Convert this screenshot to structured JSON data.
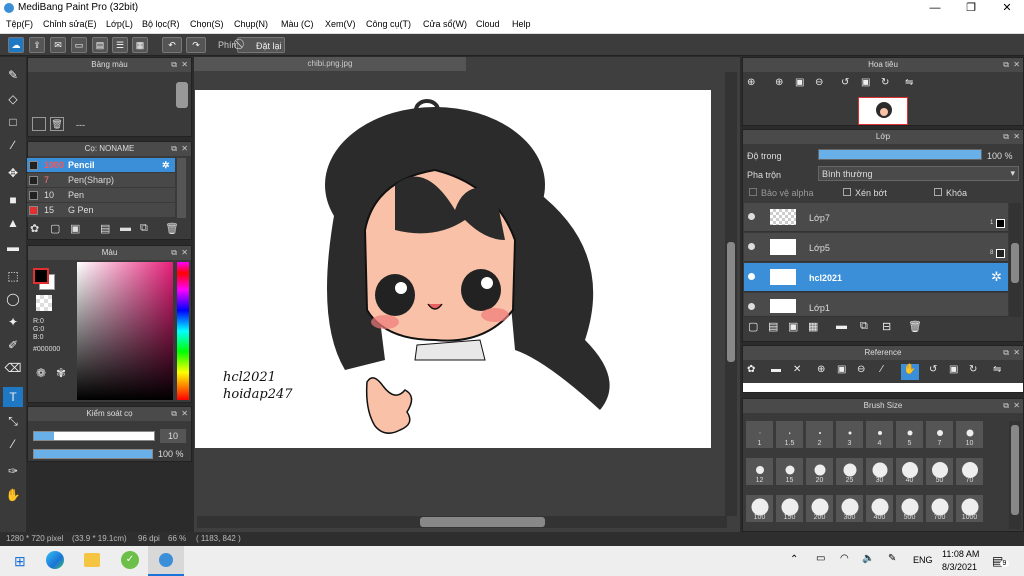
{
  "window": {
    "title": "MediBang Paint Pro (32bit)"
  },
  "menu": [
    "Tệp(F)",
    "Chỉnh sửa(E)",
    "Lớp(L)",
    "Bộ lọc(R)",
    "Chọn(S)",
    "Chụp(N)",
    "Màu (C)",
    "Xem(V)",
    "Công cụ(T)",
    "Cửa sổ(W)",
    "Cloud",
    "Help"
  ],
  "toolbar": {
    "shortcut_label": "Phím",
    "reset_label": "Đặt lại"
  },
  "panels": {
    "palette": {
      "title": "Bảng màu",
      "dash": "---"
    },
    "brush": {
      "title": "Cọ: NONAME",
      "items": [
        {
          "size": "1000",
          "name": "Pencil",
          "color": "#222222",
          "selected": true
        },
        {
          "size": "7",
          "name": "Pen(Sharp)",
          "color": "#222222",
          "selected": false
        },
        {
          "size": "10",
          "name": "Pen",
          "color": "#222222",
          "selected": false
        },
        {
          "size": "15",
          "name": "G Pen",
          "color": "#e03030",
          "selected": false
        }
      ]
    },
    "color": {
      "title": "Màu",
      "r": "R:0",
      "g": "G:0",
      "b": "B:0",
      "hex": "#000000"
    },
    "brush_control": {
      "title": "Kiểm soát cọ",
      "size": "10",
      "opacity": "100 %",
      "opacity_fraction": 1.0
    }
  },
  "canvas": {
    "tab": "chibi.png.jpg",
    "watermark1": "hcl2021",
    "watermark2": "hoidap247"
  },
  "navigator": {
    "title": "Hoa tiêu"
  },
  "layer": {
    "title": "Lớp",
    "opacity_label": "Độ trong",
    "opacity_value": "100 %",
    "opacity_fraction": 1.0,
    "blend_label": "Pha trộn",
    "blend_value": "Bình thường",
    "protect_alpha": "Bảo vệ alpha",
    "clipping": "Xén bớt",
    "lock": "Khóa",
    "items": [
      {
        "name": "Lớp7",
        "num": "1",
        "selected": false
      },
      {
        "name": "Lớp5",
        "num": "8",
        "selected": false
      },
      {
        "name": "hcl2021",
        "num": "",
        "selected": true
      },
      {
        "name": "Lớp1",
        "num": "",
        "selected": false
      }
    ]
  },
  "reference": {
    "title": "Reference"
  },
  "brush_size": {
    "title": "Brush Size",
    "sizes": [
      "1",
      "1.5",
      "2",
      "3",
      "4",
      "5",
      "7",
      "10",
      "12",
      "15",
      "20",
      "25",
      "30",
      "40",
      "50",
      "70",
      "100",
      "150",
      "200",
      "300",
      "400",
      "500",
      "700",
      "1000"
    ]
  },
  "status": {
    "dims": "1280 * 720 pixel",
    "cm": "(33.9 * 19.1cm)",
    "dpi": "96 dpi",
    "zoom": "66 %",
    "coords": "( 1183, 842 )"
  },
  "taskbar": {
    "lang": "ENG",
    "time": "11:08 AM",
    "date": "8/3/2021",
    "notif": "9"
  }
}
